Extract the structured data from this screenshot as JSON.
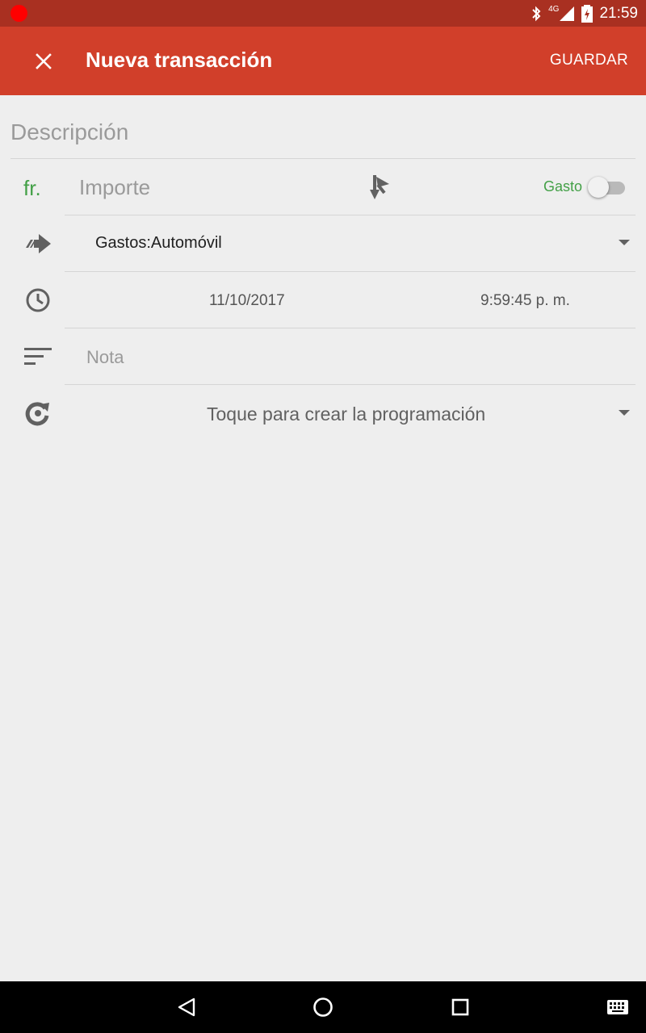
{
  "status_bar": {
    "time": "21:59",
    "network_label": "4G"
  },
  "app_bar": {
    "title": "Nueva transacción",
    "save_label": "GUARDAR"
  },
  "form": {
    "description_placeholder": "Descripción",
    "currency_symbol": "fr.",
    "amount_placeholder": "Importe",
    "type_label": "Gasto",
    "type_toggle_on": false,
    "account": "Gastos:Automóvil",
    "date": "11/10/2017",
    "time": "9:59:45 p. m.",
    "note_placeholder": "Nota",
    "schedule_prompt": "Toque para crear la programación"
  },
  "colors": {
    "status_bar": "#a93021",
    "app_bar": "#d13f2a",
    "accent_green": "#43a047",
    "background": "#eeeeee"
  },
  "icons": {
    "close": "close-icon",
    "split": "split-icon",
    "account": "transfer-arrow-icon",
    "time": "clock-icon",
    "note": "notes-icon",
    "schedule": "recurrence-icon"
  }
}
